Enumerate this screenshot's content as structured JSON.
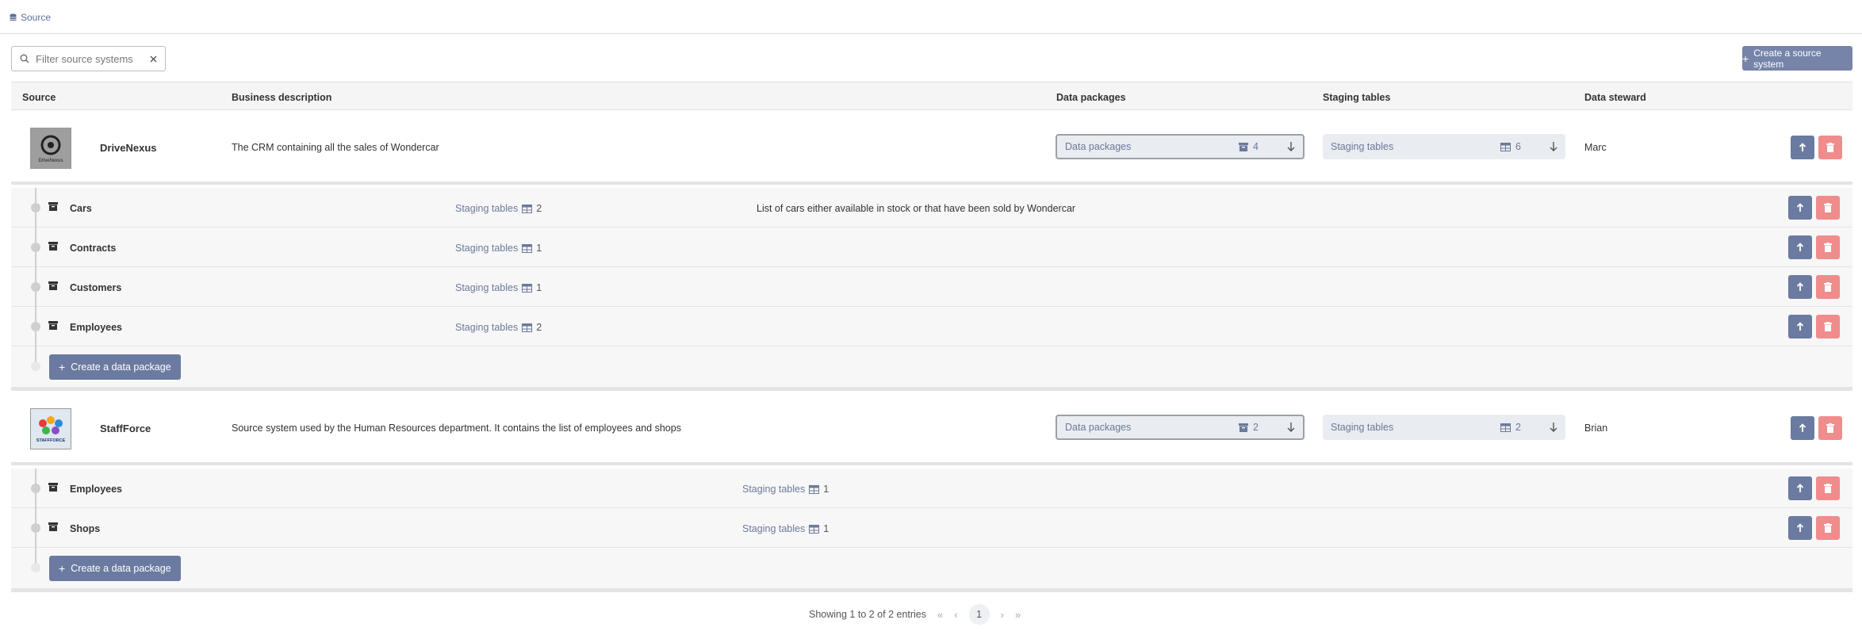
{
  "breadcrumb": {
    "label": "Source"
  },
  "search": {
    "placeholder": "Filter source systems"
  },
  "create_source_label": "Create a source system",
  "headers": {
    "source": "Source",
    "description": "Business description",
    "data_packages": "Data packages",
    "staging_tables": "Staging tables",
    "data_steward": "Data steward"
  },
  "sources": [
    {
      "name": "DriveNexus",
      "logo_text": "DriveNexus",
      "description": "The CRM containing all the sales of Wondercar",
      "data_packages_label": "Data packages",
      "data_packages_count": "4",
      "staging_tables_label": "Staging tables",
      "staging_tables_count": "6",
      "steward": "Marc",
      "packages": [
        {
          "name": "Cars",
          "staging_label": "Staging tables",
          "staging_count": "2",
          "description": "List of cars either available in stock or that have been sold by Wondercar"
        },
        {
          "name": "Contracts",
          "staging_label": "Staging tables",
          "staging_count": "1",
          "description": ""
        },
        {
          "name": "Customers",
          "staging_label": "Staging tables",
          "staging_count": "1",
          "description": ""
        },
        {
          "name": "Employees",
          "staging_label": "Staging tables",
          "staging_count": "2",
          "description": ""
        }
      ],
      "create_package_label": "Create a data package"
    },
    {
      "name": "StaffForce",
      "logo_text": "STAFFFORCE",
      "description": "Source system used by the Human Resources department. It contains the list of employees and shops",
      "data_packages_label": "Data packages",
      "data_packages_count": "2",
      "staging_tables_label": "Staging tables",
      "staging_tables_count": "2",
      "steward": "Brian",
      "packages": [
        {
          "name": "Employees",
          "staging_label": "Staging tables",
          "staging_count": "1",
          "description": ""
        },
        {
          "name": "Shops",
          "staging_label": "Staging tables",
          "staging_count": "1",
          "description": ""
        }
      ],
      "create_package_label": "Create a data package"
    }
  ],
  "pagination": {
    "summary": "Showing 1 to 2 of 2 entries",
    "current_page": "1",
    "first": "«",
    "prev": "‹",
    "next": "›",
    "last": "»"
  },
  "colors": {
    "primary": "#6b7aa0",
    "danger": "#f08c8c",
    "link": "#6b7a9a"
  }
}
